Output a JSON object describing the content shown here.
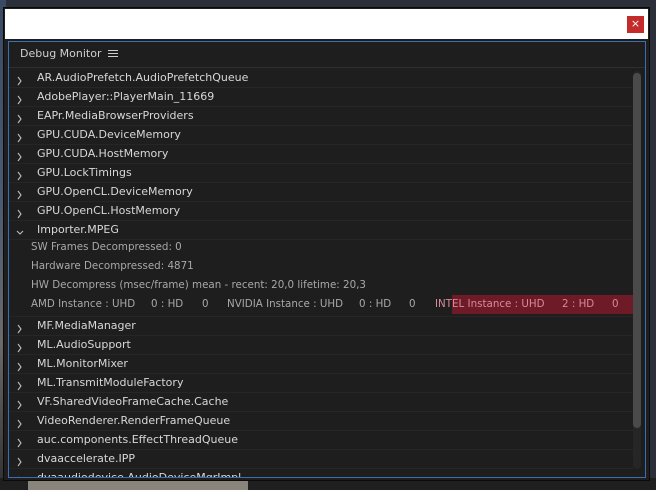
{
  "window": {
    "close_label": "×",
    "panel_title": "Debug Monitor",
    "menu_icon": "hamburger-menu-icon"
  },
  "rows_top": [
    {
      "label": "AR.AudioPrefetch.AudioPrefetchQueue",
      "expanded": false
    },
    {
      "label": "AdobePlayer::PlayerMain_11669",
      "expanded": false
    },
    {
      "label": "EAPr.MediaBrowserProviders",
      "expanded": false
    },
    {
      "label": "GPU.CUDA.DeviceMemory",
      "expanded": false
    },
    {
      "label": "GPU.CUDA.HostMemory",
      "expanded": false
    },
    {
      "label": "GPU.LockTimings",
      "expanded": false
    },
    {
      "label": "GPU.OpenCL.DeviceMemory",
      "expanded": false
    },
    {
      "label": "GPU.OpenCL.HostMemory",
      "expanded": false
    },
    {
      "label": "Importer.MPEG",
      "expanded": true
    }
  ],
  "importer_details": {
    "sw_frames": "SW Frames Decompressed: 0",
    "hw_decompressed": "Hardware Decompressed: 4871",
    "hw_mean": "HW Decompress (msec/frame) mean - recent:  20,0 lifetime:  20,3",
    "instances": [
      {
        "label": "AMD Instance : UHD",
        "hd": "0 : HD",
        "value": "0",
        "highlighted": false
      },
      {
        "label": "NVIDIA Instance : UHD",
        "hd": "0 : HD",
        "value": "0",
        "highlighted": false
      },
      {
        "label": "INTEL Instance : UHD",
        "hd": "2 : HD",
        "value": "0",
        "highlighted": true
      }
    ]
  },
  "rows_bottom": [
    {
      "label": "MF.MediaManager",
      "expanded": false
    },
    {
      "label": "ML.AudioSupport",
      "expanded": false
    },
    {
      "label": "ML.MonitorMixer",
      "expanded": false
    },
    {
      "label": "ML.TransmitModuleFactory",
      "expanded": false
    },
    {
      "label": "VF.SharedVideoFrameCache.Cache",
      "expanded": false
    },
    {
      "label": "VideoRenderer.RenderFrameQueue",
      "expanded": false
    },
    {
      "label": "auc.components.EffectThreadQueue",
      "expanded": false
    },
    {
      "label": "dvaaccelerate.IPP",
      "expanded": false
    },
    {
      "label": "dvaaudiodevice.AudioDeviceMgrImpl",
      "expanded": false
    }
  ],
  "colors": {
    "panel_border": "#3a6fb6",
    "highlight": "#6e1a27",
    "close_button": "#c42b2b"
  }
}
